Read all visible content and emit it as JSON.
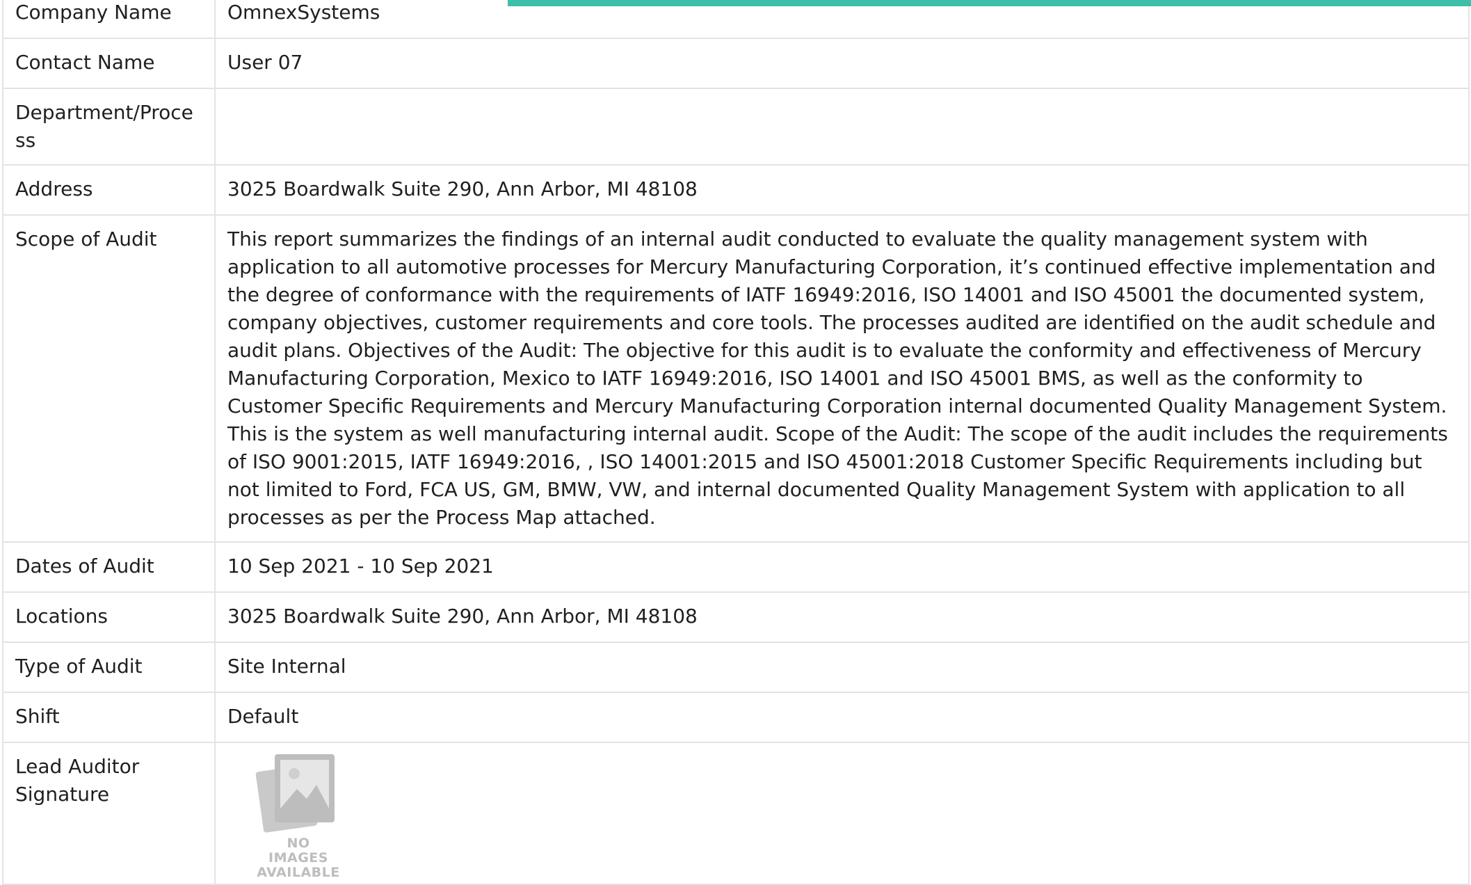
{
  "progress": {
    "color": "#3dbfa9",
    "fill_fraction": 0.655
  },
  "rows": [
    {
      "label": "Company Name",
      "value": "OmnexSystems"
    },
    {
      "label": "Contact Name",
      "value": "User 07"
    },
    {
      "label": "Department/Process",
      "value": ""
    },
    {
      "label": "Address",
      "value": "3025 Boardwalk Suite 290, Ann Arbor, MI 48108"
    },
    {
      "label": "Scope of Audit",
      "value": "This report summarizes the findings of an internal audit conducted to evaluate the quality management system with application to all automotive processes for Mercury Manufacturing Corporation, it’s continued effective implementation and the degree of conformance with the requirements of IATF 16949:2016, ISO 14001 and ISO 45001 the documented system, company objectives, customer requirements and core tools. The processes audited are identified on the audit schedule and audit plans. Objectives of the Audit: The objective for this audit is to evaluate the conformity and effectiveness of Mercury Manufacturing Corporation, Mexico to IATF 16949:2016, ISO 14001 and ISO 45001 BMS, as well as the conformity to Customer Specific Requirements and Mercury Manufacturing Corporation internal documented Quality Management System. This is the system as well manufacturing internal audit. Scope of the Audit: The scope of the audit includes the requirements of ISO 9001:2015, IATF 16949:2016, , ISO 14001:2015 and ISO 45001:2018 Customer Specific Requirements including but not limited to Ford, FCA US, GM, BMW, VW, and internal documented Quality Management System with application to all processes as per the Process Map attached."
    },
    {
      "label": "Dates of Audit",
      "value": "10 Sep 2021 - 10 Sep 2021"
    },
    {
      "label": "Locations",
      "value": "3025 Boardwalk Suite 290, Ann Arbor, MI 48108"
    },
    {
      "label": "Type of Audit",
      "value": "Site Internal"
    },
    {
      "label": "Shift",
      "value": "Default"
    },
    {
      "label": "Lead Auditor Signature",
      "value": ""
    }
  ],
  "signature_placeholder": {
    "icon": "no-image-icon",
    "line1": "NO IMAGES",
    "line2": "AVAILABLE"
  }
}
